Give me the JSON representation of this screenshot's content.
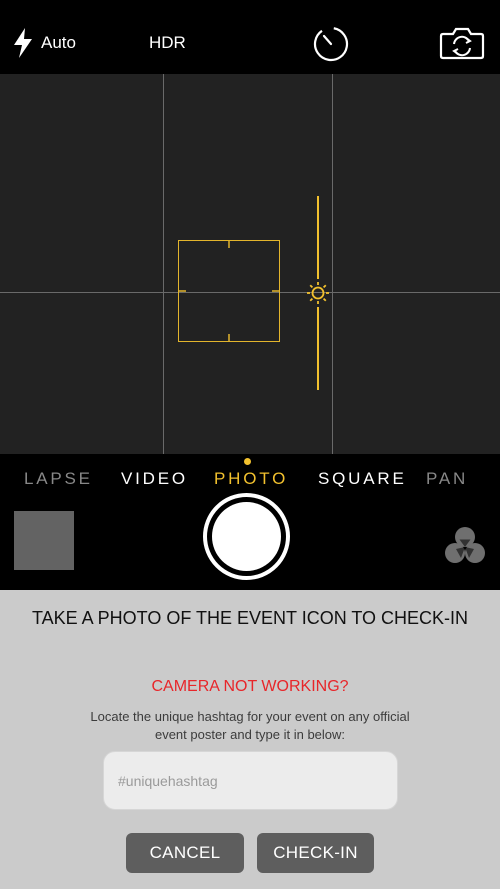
{
  "topbar": {
    "flash_label": "Auto",
    "hdr_label": "HDR",
    "icons": [
      "flash-icon",
      "timer-icon",
      "switch-camera-icon"
    ]
  },
  "camera_modes": {
    "items": [
      "LAPSE",
      "VIDEO",
      "PHOTO",
      "SQUARE",
      "PAN"
    ],
    "selected": "PHOTO"
  },
  "controls": {
    "icons": [
      "shutter-button",
      "filters-icon"
    ]
  },
  "checkin_panel": {
    "title": "TAKE A PHOTO OF THE EVENT ICON TO CHECK-IN",
    "alert": "CAMERA NOT WORKING?",
    "help_text": "Locate the unique hashtag for your event on any official event poster and type it in below:",
    "hashtag_placeholder": "#uniquehashtag",
    "hashtag_value": "",
    "cancel_label": "CANCEL",
    "checkin_label": "CHECK-IN"
  },
  "colors": {
    "accent_yellow": "#f2c12e",
    "alert_red": "#e8262a",
    "panel_bg": "#cbcbcb",
    "button_bg": "#5e5e5e",
    "viewfinder_bg": "#222222"
  }
}
